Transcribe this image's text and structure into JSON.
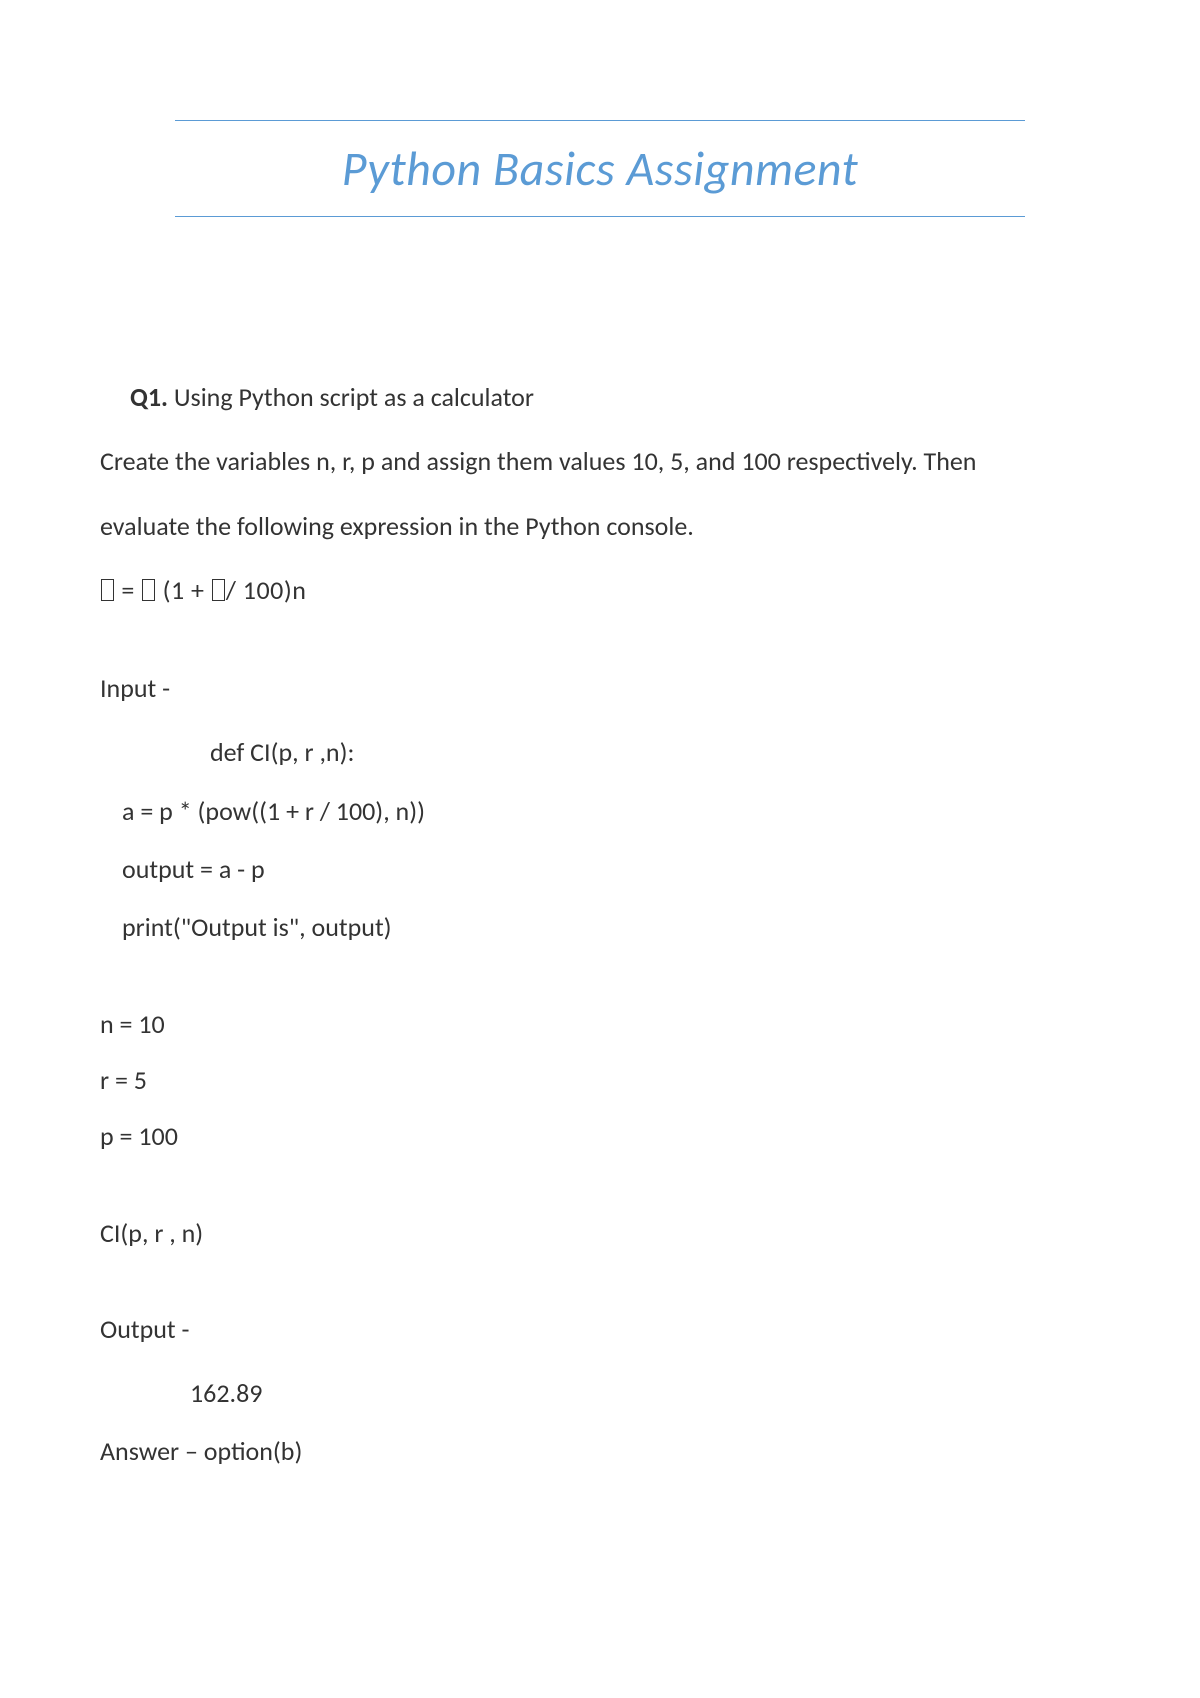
{
  "title": "Python Basics Assignment",
  "q1": {
    "label": "Q1.",
    "heading": " Using Python script as a calculator",
    "para1": "Create the variables n, r, p and assign them values 10, 5, and 100 respectively. Then",
    "para2": "evaluate the following expression in the Python console.",
    "formula_parts": {
      "p1": " = ",
      "p2": " (1 + ",
      "p3": "/ 100)n"
    }
  },
  "input_label": "Input -",
  "code": {
    "def_line": "def CI(p, r ,n):",
    "line1": "a = p * (pow((1 + r / 100), n))",
    "line2": "output = a - p",
    "line3": "print(\"Output is\", output)"
  },
  "assigns": {
    "n": "n = 10",
    "r": "r = 5",
    "p": "p = 100"
  },
  "call": "CI(p, r , n)",
  "output_label": "Output -",
  "output_value": "162.89",
  "answer": "Answer – option(b)"
}
